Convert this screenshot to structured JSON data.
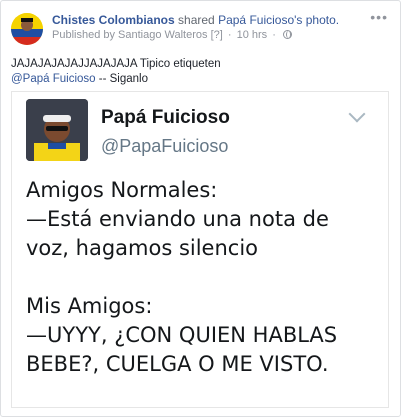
{
  "post": {
    "page_name": "Chistes Colombianos",
    "verb": "shared",
    "photo_owner": "Papá Fuicioso",
    "photo_suffix": "'s photo.",
    "published_by": "Published by Santiago Walteros",
    "help_marker": "[?]",
    "separator": "·",
    "time": "10 hrs",
    "more_label": "•••",
    "message_line1": "JAJAJAJAJAJJAJAJAJA Tipico etiqueten",
    "message_mention": "@Papá Fuicioso",
    "message_tail": "-- Siganlo"
  },
  "tweet": {
    "name": "Papá Fuicioso",
    "handle": "@PapaFuicioso",
    "lines": [
      "Amigos Normales:",
      "—Está enviando una nota de",
      "voz, hagamos silencio",
      "",
      "Mis Amigos:",
      "—UYYY, ¿CON QUIEN HABLAS",
      "BEBE?, CUELGA O ME VISTO."
    ]
  },
  "colors": {
    "link": "#365899",
    "meta": "#90949c",
    "text": "#1d2129"
  },
  "icons": {
    "page_avatar": "page-avatar-icon",
    "privacy": "globe-icon",
    "menu": "more-options-icon",
    "tweet_menu": "chevron-down-icon"
  }
}
